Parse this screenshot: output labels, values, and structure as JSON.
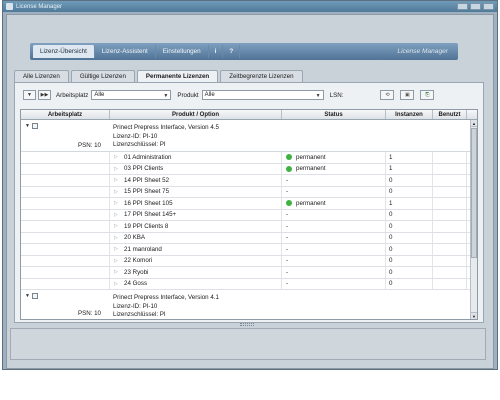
{
  "window": {
    "title": "License Manager"
  },
  "nav": {
    "tabs": [
      "Lizenz-Übersicht",
      "Lizenz-Assistent",
      "Einstellungen",
      "i",
      "?"
    ],
    "active_index": 0,
    "brand": "License Manager"
  },
  "subtabs": {
    "items": [
      "Alle Lizenzen",
      "Gültige Lizenzen",
      "Permanente Lizenzen",
      "Zeitbegrenzte Lizenzen"
    ],
    "active_index": 2
  },
  "filter": {
    "workplace_label": "Arbeitsplatz",
    "workplace_value": "Alle",
    "product_label": "Produkt",
    "product_value": "Alle",
    "lsn_label": "LSN:"
  },
  "table": {
    "columns": [
      "Arbeitsplatz",
      "Produkt / Option",
      "Status",
      "Instanzen",
      "Benutzt"
    ],
    "groups": [
      {
        "psn": "PSN: 10",
        "product": "Prinect Prepress Interface, Version 4.5",
        "license_id": "Lizenz-ID: PI-10",
        "license_key": "Lizenzschlüssel: PI",
        "rows": [
          {
            "option": "01 Administration",
            "status": "permanent",
            "instances": "1"
          },
          {
            "option": "03 PPI Clients",
            "status": "permanent",
            "instances": "1"
          },
          {
            "option": "14 PPI Sheet 52",
            "status": "-",
            "instances": "0"
          },
          {
            "option": "15 PPI Sheet 75",
            "status": "-",
            "instances": "0"
          },
          {
            "option": "16 PPI Sheet 105",
            "status": "permanent",
            "instances": "1"
          },
          {
            "option": "17 PPI Sheet 145+",
            "status": "-",
            "instances": "0"
          },
          {
            "option": "19 PPI Clients 8",
            "status": "-",
            "instances": "0"
          },
          {
            "option": "20 KBA",
            "status": "-",
            "instances": "0"
          },
          {
            "option": "21 manroland",
            "status": "-",
            "instances": "0"
          },
          {
            "option": "22 Komori",
            "status": "-",
            "instances": "0"
          },
          {
            "option": "23 Ryobi",
            "status": "-",
            "instances": "0"
          },
          {
            "option": "24 Goss",
            "status": "-",
            "instances": "0"
          }
        ]
      },
      {
        "psn": "PSN: 10",
        "product": "Prinect Prepress Interface, Version 4.1",
        "license_id": "Lizenz-ID: PI-10",
        "license_key": "Lizenzschlüssel: PI"
      }
    ]
  },
  "colors": {
    "status_permanent": "#3fb33f",
    "nav_bar": "#5f83a6"
  }
}
